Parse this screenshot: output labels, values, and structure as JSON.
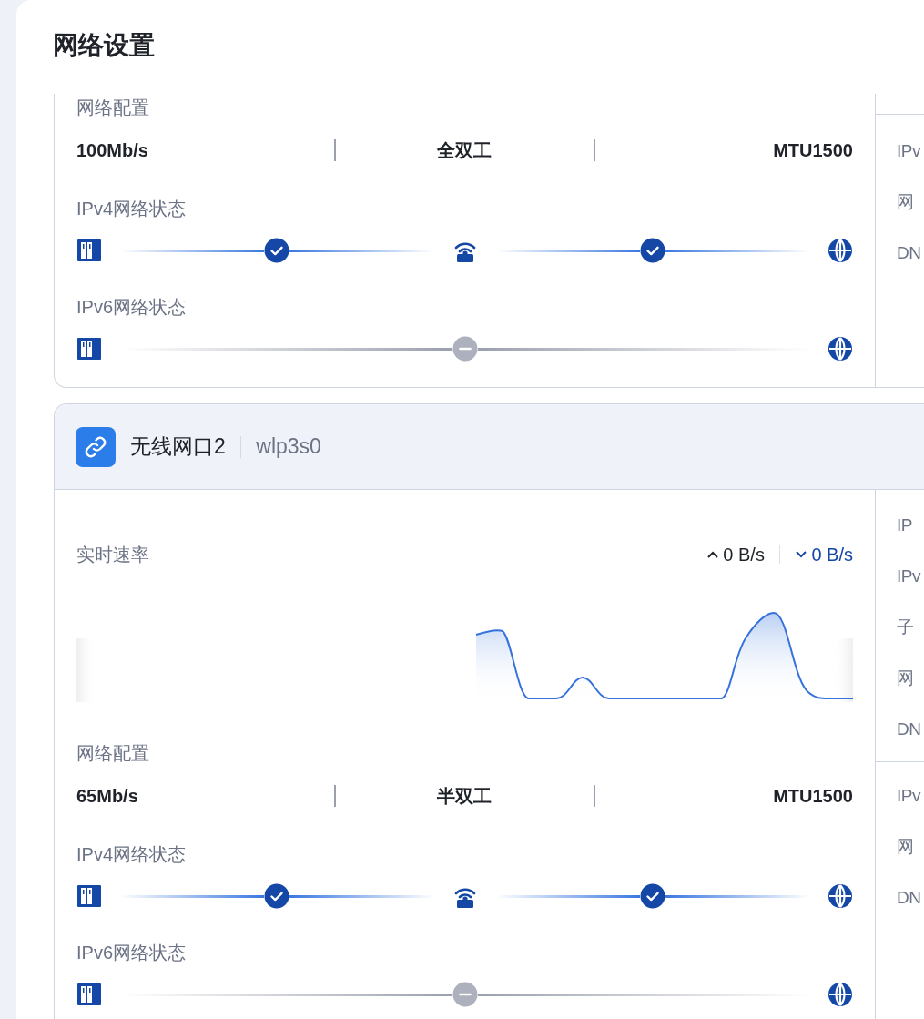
{
  "title": "网络设置",
  "cards": [
    {
      "kind": "scrolled",
      "config": {
        "label": "网络配置",
        "speed": "100Mb/s",
        "duplex": "全双工",
        "mtu": "MTU1500"
      },
      "statuses": [
        {
          "label": "IPv4网络状态",
          "nodes": [
            {
              "kind": "device"
            },
            {
              "kind": "link",
              "connected": true
            },
            {
              "kind": "router"
            },
            {
              "kind": "link",
              "connected": true
            },
            {
              "kind": "globe"
            }
          ]
        },
        {
          "label": "IPv6网络状态",
          "nodes": [
            {
              "kind": "device"
            },
            {
              "kind": "link",
              "connected": false
            },
            {
              "kind": "globe"
            }
          ]
        }
      ],
      "info_sections": [
        {
          "rows": [
            "IPv",
            "网",
            "DN"
          ]
        }
      ]
    },
    {
      "kind": "full",
      "name": "无线网口2",
      "device": "wlp3s0",
      "rate": {
        "label": "实时速率",
        "upload": "0 B/s",
        "download": "0 B/s"
      },
      "config": {
        "label": "网络配置",
        "speed": "65Mb/s",
        "duplex": "半双工",
        "mtu": "MTU1500"
      },
      "statuses": [
        {
          "label": "IPv4网络状态",
          "nodes": [
            {
              "kind": "device"
            },
            {
              "kind": "link",
              "connected": true
            },
            {
              "kind": "router"
            },
            {
              "kind": "link",
              "connected": true
            },
            {
              "kind": "globe"
            }
          ]
        },
        {
          "label": "IPv6网络状态",
          "nodes": [
            {
              "kind": "device"
            },
            {
              "kind": "link",
              "connected": false
            },
            {
              "kind": "globe"
            }
          ]
        }
      ],
      "info_sections": [
        {
          "rows": [
            "IP",
            "IPv",
            "子",
            "网",
            "DN"
          ]
        },
        {
          "rows": [
            "IPv",
            "网",
            "DN"
          ]
        }
      ]
    }
  ]
}
